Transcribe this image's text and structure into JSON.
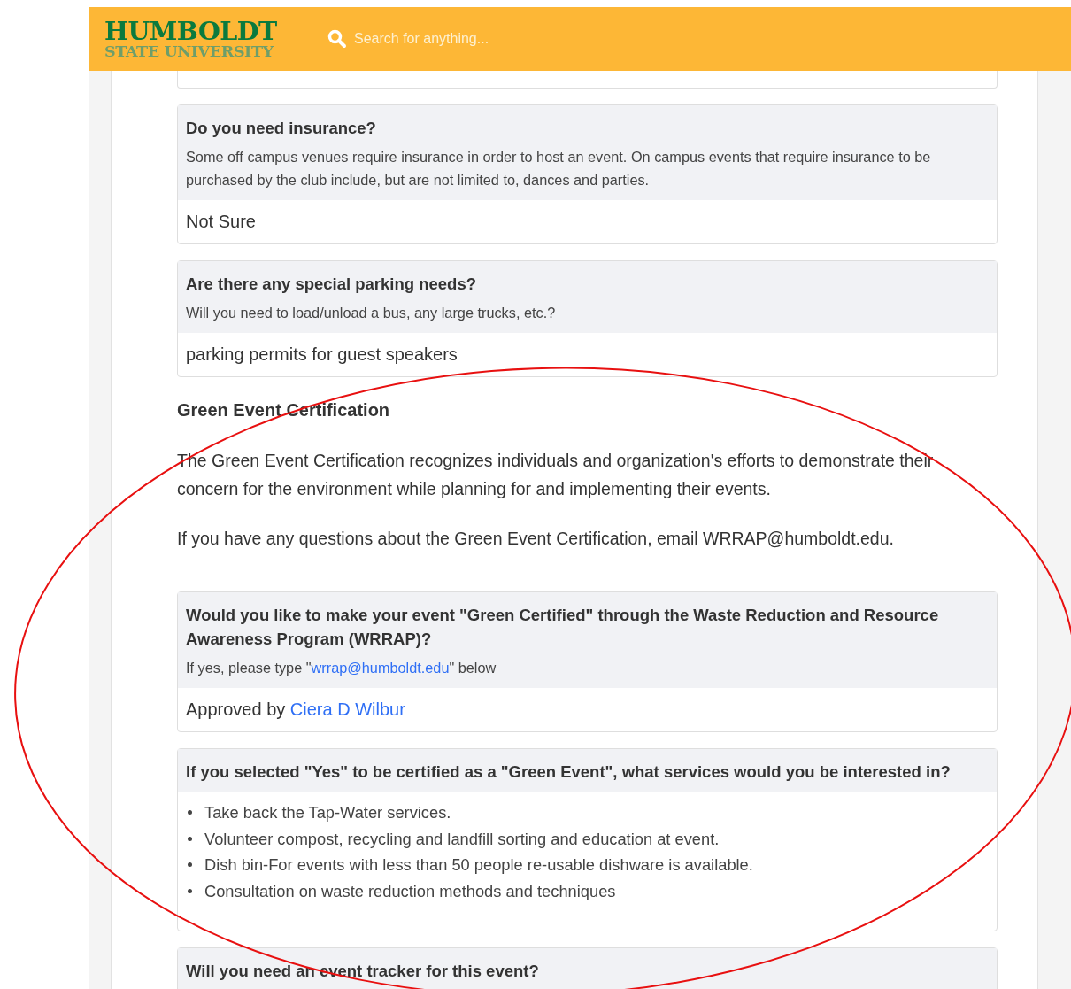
{
  "header": {
    "logo_line1": "HUMBOLDT",
    "logo_line2": "STATE UNIVERSITY",
    "search": {
      "placeholder": "Search for anything..."
    }
  },
  "questions_top": [
    {
      "question": "Do you need insurance?",
      "help": "Some off campus venues require insurance in order to host an event. On campus events that require insurance to be purchased by the club include, but are not limited to, dances and parties.",
      "answer": "Not Sure"
    },
    {
      "question": "Are there any special parking needs?",
      "help": "Will you need to load/unload a bus, any large trucks, etc.?",
      "answer": "parking permits for guest speakers"
    }
  ],
  "section": {
    "heading": "Green Event Certification",
    "paragraphs": [
      "The Green Event Certification recognizes individuals and organization's efforts to demonstrate their concern for the environment while planning for and implementing their events.",
      "If you have any questions about the Green Event Certification, email WRRAP@humboldt.edu."
    ]
  },
  "green_question": {
    "question": "Would you like to make your event \"Green Certified\" through the Waste Reduction and Resource Awareness Program (WRRAP)?",
    "help_before": "If yes, please type \"",
    "help_link": "wrrap@humboldt.edu",
    "help_after": "\" below",
    "answer_prefix": "Approved by",
    "answer_link": "Ciera D Wilbur"
  },
  "services_question": {
    "question": "If you selected \"Yes\" to be certified as a \"Green Event\", what services would you be interested in?",
    "items": [
      "Take back the Tap-Water services.",
      "Volunteer compost, recycling and landfill sorting and education at event.",
      "Dish bin-For events with less than 50 people re-usable dishware is available.",
      "Consultation on waste reduction methods and techniques"
    ]
  },
  "last_question": {
    "question": "Will you need an event tracker for this event?"
  },
  "annotation": {
    "kind": "ellipse"
  }
}
